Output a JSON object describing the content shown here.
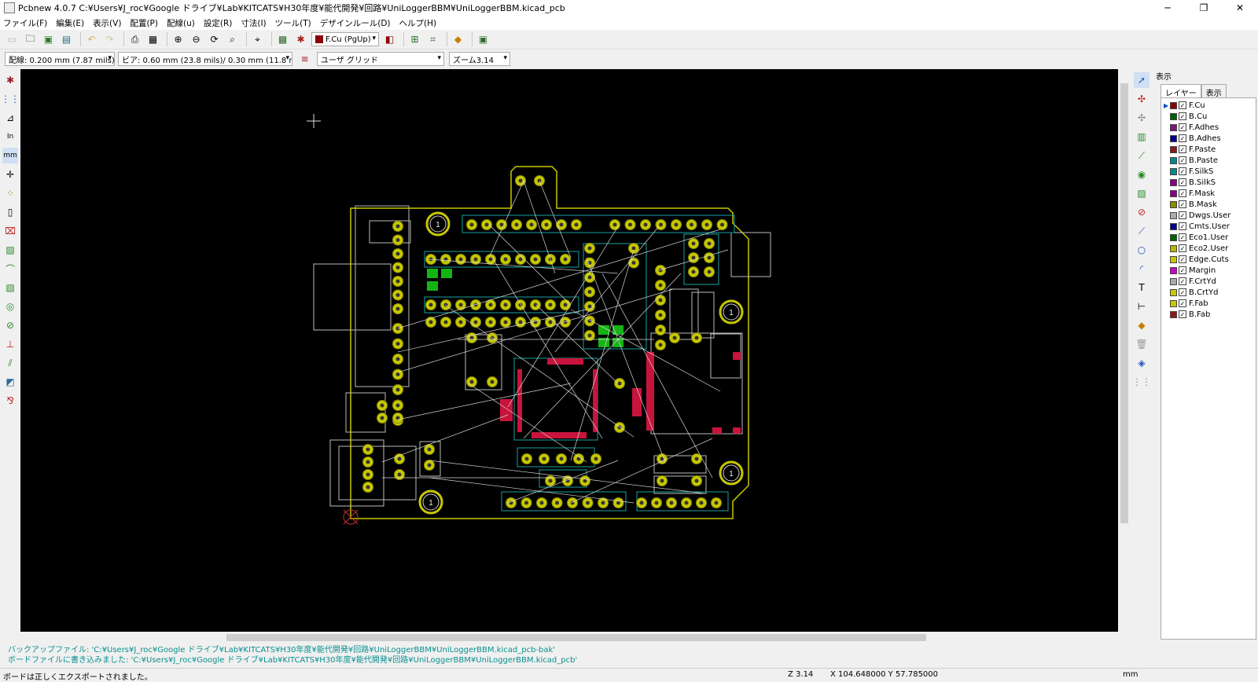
{
  "window": {
    "title": "Pcbnew 4.0.7 C:¥Users¥J_roc¥Google ドライブ¥Lab¥KITCATS¥H30年度¥能代開発¥回路¥UniLoggerBBM¥UniLoggerBBM.kicad_pcb",
    "minimize": "─",
    "maximize": "❐",
    "close": "✕"
  },
  "menu": [
    "ファイル(F)",
    "編集(E)",
    "表示(V)",
    "配置(P)",
    "配線(u)",
    "設定(R)",
    "寸法(I)",
    "ツール(T)",
    "デザインルール(D)",
    "ヘルプ(H)"
  ],
  "toolbar1": {
    "layer_select": "F.Cu (PgUp)",
    "layer_color": "#8b0000"
  },
  "toolbar2": {
    "track_width": "配線: 0.200 mm (7.87 mils) *",
    "via_size": "ビア: 0.60 mm (23.8 mils)/ 0.30 mm (11.8 mils) *",
    "grid": "ユーザ グリッド",
    "zoom": "ズーム3.14"
  },
  "board": {
    "mount_hole_label": "1"
  },
  "panel": {
    "title": "表示",
    "tabs": [
      "レイヤー",
      "表示"
    ],
    "layers": [
      {
        "name": "F.Cu",
        "color": "#8b0000",
        "active": true
      },
      {
        "name": "B.Cu",
        "color": "#006400"
      },
      {
        "name": "F.Adhes",
        "color": "#7a1a7a"
      },
      {
        "name": "B.Adhes",
        "color": "#00008b"
      },
      {
        "name": "F.Paste",
        "color": "#8b1a1a"
      },
      {
        "name": "B.Paste",
        "color": "#008b8b"
      },
      {
        "name": "F.SilkS",
        "color": "#008b8b"
      },
      {
        "name": "B.SilkS",
        "color": "#8b008b"
      },
      {
        "name": "F.Mask",
        "color": "#8b008b"
      },
      {
        "name": "B.Mask",
        "color": "#8b8b00"
      },
      {
        "name": "Dwgs.User",
        "color": "#aaaaaa"
      },
      {
        "name": "Cmts.User",
        "color": "#00008b"
      },
      {
        "name": "Eco1.User",
        "color": "#006400"
      },
      {
        "name": "Eco2.User",
        "color": "#b8b800"
      },
      {
        "name": "Edge.Cuts",
        "color": "#c8c800"
      },
      {
        "name": "Margin",
        "color": "#c800c8"
      },
      {
        "name": "F.CrtYd",
        "color": "#aaaaaa"
      },
      {
        "name": "B.CrtYd",
        "color": "#c8c800"
      },
      {
        "name": "F.Fab",
        "color": "#c8c800"
      },
      {
        "name": "B.Fab",
        "color": "#8b1a1a"
      }
    ]
  },
  "messages": [
    "バックアップファイル: 'C:¥Users¥J_roc¥Google ドライブ¥Lab¥KITCATS¥H30年度¥能代開発¥回路¥UniLoggerBBM¥UniLoggerBBM.kicad_pcb-bak'",
    "ボードファイルに書き込みました: 'C:¥Users¥J_roc¥Google ドライブ¥Lab¥KITCATS¥H30年度¥能代開発¥回路¥UniLoggerBBM¥UniLoggerBBM.kicad_pcb'"
  ],
  "status": {
    "message": "ボードは正しくエクスポートされました。",
    "zoom": "Z 3.14",
    "coords": "X 104.648000  Y 57.785000",
    "units": "mm"
  }
}
